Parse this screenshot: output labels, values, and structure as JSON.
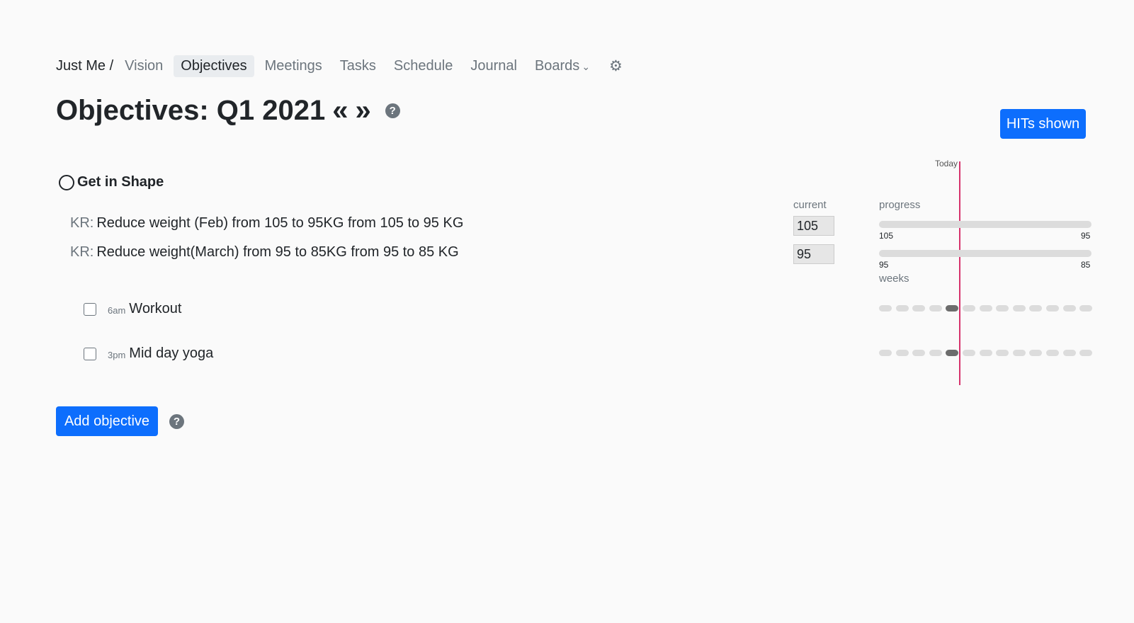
{
  "nav": {
    "crumb": "Just Me /",
    "items": [
      {
        "label": "Vision",
        "active": false
      },
      {
        "label": "Objectives",
        "active": true
      },
      {
        "label": "Meetings",
        "active": false
      },
      {
        "label": "Tasks",
        "active": false
      },
      {
        "label": "Schedule",
        "active": false
      },
      {
        "label": "Journal",
        "active": false
      },
      {
        "label": "Boards",
        "active": false
      }
    ],
    "gear_icon": "gear-icon"
  },
  "header": {
    "title": "Objectives: Q1 2021",
    "prev_glyph": "«",
    "next_glyph": "»",
    "help_glyph": "?",
    "hits_button": "HITs shown"
  },
  "timeline": {
    "today_label": "Today"
  },
  "columns": {
    "current": "current",
    "progress": "progress",
    "weeks": "weeks"
  },
  "objective": {
    "title": "Get in Shape",
    "krs": [
      {
        "prefix": "KR:",
        "text": "Reduce weight (Feb) from 105 to 95KG from 105 to 95 KG",
        "current": "105",
        "start": "105",
        "end": "95",
        "progress": 0
      },
      {
        "prefix": "KR:",
        "text": "Reduce weight(March) from 95 to 85KG from 95 to 85 KG",
        "current": "95",
        "start": "95",
        "end": "85",
        "progress": 0
      }
    ],
    "habits": [
      {
        "time": "6am",
        "label": "Workout",
        "weeks": 13,
        "current_week": 5
      },
      {
        "time": "3pm",
        "label": "Mid day yoga",
        "weeks": 13,
        "current_week": 5
      }
    ]
  },
  "footer": {
    "add_button": "Add objective",
    "help_glyph": "?"
  },
  "colors": {
    "primary": "#0d6efd",
    "today": "#d6336c"
  }
}
